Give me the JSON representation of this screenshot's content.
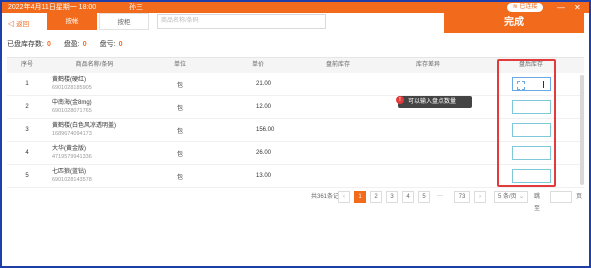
{
  "titlebar": {
    "date": "2022年4月11日星期一 18:00",
    "user": "孙三",
    "wifi": "已连接",
    "min": "—",
    "close": "✕"
  },
  "toolbar": {
    "back_label": "返回",
    "tabs": [
      {
        "label": "按帐"
      },
      {
        "label": "按柜"
      }
    ],
    "search_placeholder": "商品名称/条码",
    "done_label": "完成"
  },
  "stats": [
    {
      "label": "已盘库存数:",
      "value": "0"
    },
    {
      "label": "盘盈:",
      "value": "0"
    },
    {
      "label": "盘亏:",
      "value": "0"
    }
  ],
  "table": {
    "headers": [
      "序号",
      "商品名称/条码",
      "单位",
      "单价",
      "盘前库存",
      "库存差异",
      "盘后库存"
    ],
    "rows": [
      {
        "index": "1",
        "name": "黄鹤楼(硬红)",
        "code": "6901028185905",
        "unit": "包",
        "price": "21.00"
      },
      {
        "index": "2",
        "name": "中南海(金8mg)",
        "code": "6901028071765",
        "unit": "包",
        "price": "12.00"
      },
      {
        "index": "3",
        "name": "黄鹤楼(白色风凉透明盖)",
        "code": "1689674094173",
        "unit": "包",
        "price": "156.00"
      },
      {
        "index": "4",
        "name": "大华(黄金版)",
        "code": "4719579941336",
        "unit": "包",
        "price": "26.00"
      },
      {
        "index": "5",
        "name": "七匹狼(蓝钻)",
        "code": "6901028143578",
        "unit": "包",
        "price": "13.00"
      }
    ]
  },
  "tooltip": {
    "badge": "!",
    "text": "可以输入盘点数量"
  },
  "pagination": {
    "total": "共361条记录",
    "prev": "‹",
    "pages": [
      "1",
      "2",
      "3",
      "4",
      "5",
      "···",
      "73"
    ],
    "next": "›",
    "page_size": "5 条/页",
    "goto_label": "跳至",
    "goto_suffix": "页"
  },
  "colors": {
    "accent": "#f26b1d",
    "highlight": "#e23b3b",
    "frame": "#1f3fa8"
  }
}
